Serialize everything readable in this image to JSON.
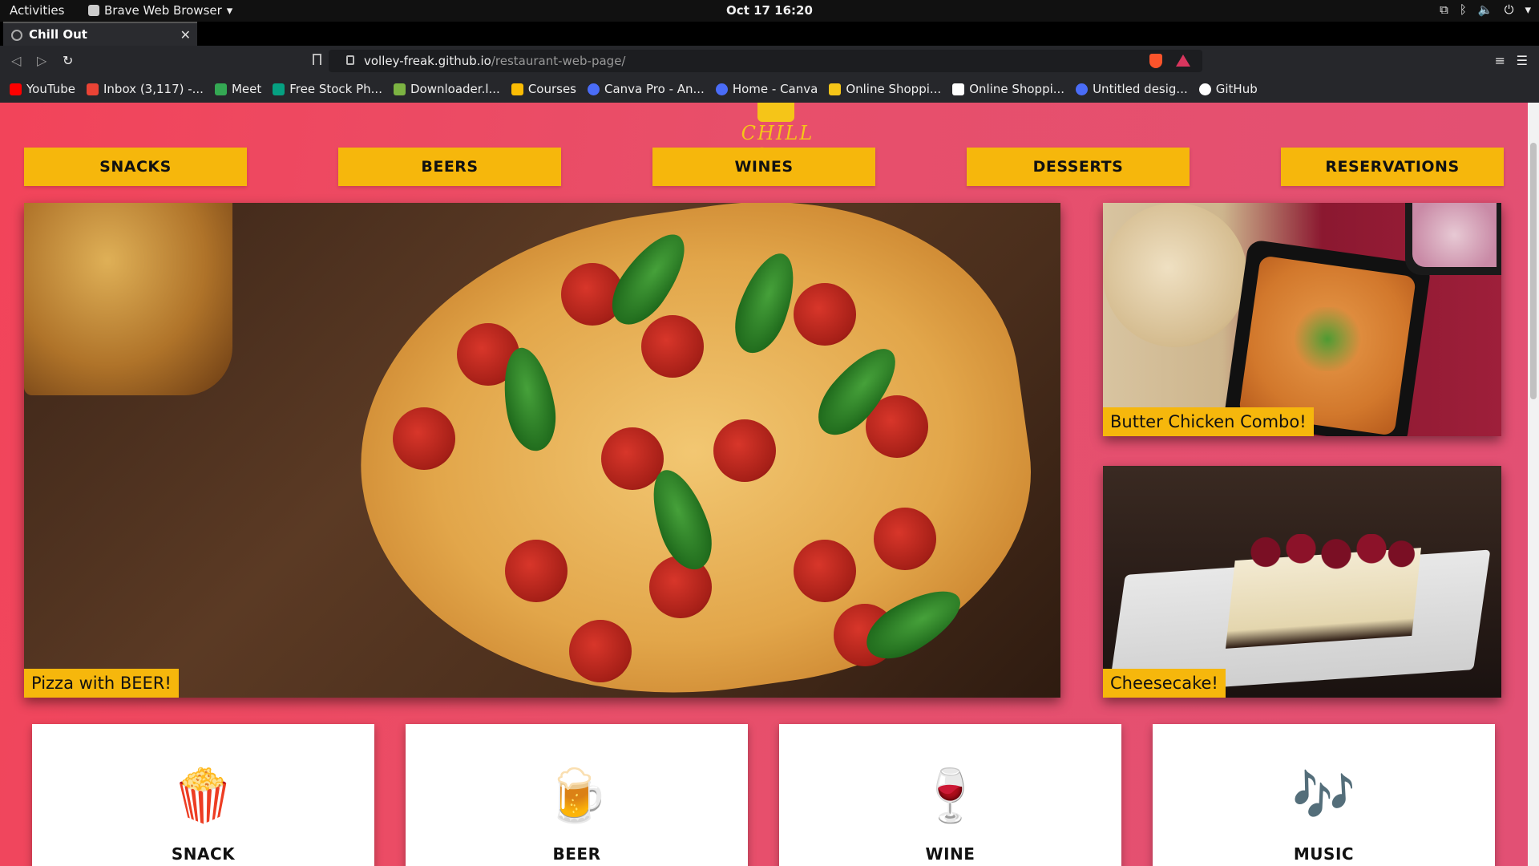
{
  "system": {
    "activities": "Activities",
    "app_name": "Brave Web Browser",
    "clock": "Oct 17  16:20"
  },
  "browser": {
    "tab_title": "Chill Out",
    "url_host": "volley-freak.github.io",
    "url_path": "/restaurant-web-page/",
    "bookmarks": [
      {
        "label": "YouTube",
        "color": "#ff0000"
      },
      {
        "label": "Inbox (3,117) -...",
        "color": "#ea4335"
      },
      {
        "label": "Meet",
        "color": "#34a853"
      },
      {
        "label": "Free Stock Ph...",
        "color": "#05a081"
      },
      {
        "label": "Downloader.l...",
        "color": "#7cb342"
      },
      {
        "label": "Courses",
        "color": "#fbbc04"
      },
      {
        "label": "Canva Pro - An...",
        "color": "#4a6cf7"
      },
      {
        "label": "Home - Canva",
        "color": "#4a6cf7"
      },
      {
        "label": "Online Shoppi...",
        "color": "#f5c518"
      },
      {
        "label": "Online Shoppi...",
        "color": "#ffffff"
      },
      {
        "label": "Untitled desig...",
        "color": "#4a6cf7"
      },
      {
        "label": "GitHub",
        "color": "#ffffff"
      }
    ]
  },
  "site": {
    "logo_text": "CHILL OUT",
    "brand_color": "#f6b70c",
    "nav": [
      "SNACKS",
      "BEERS",
      "WINES",
      "DESSERTS",
      "RESERVATIONS"
    ],
    "tiles": {
      "main_caption": "Pizza with BEER!",
      "side1_caption": "Butter Chicken Combo!",
      "side2_caption": "Cheesecake!"
    },
    "cards": [
      {
        "title": "SNACK",
        "icon": "snack-icon",
        "glyph": "🍿"
      },
      {
        "title": "BEER",
        "icon": "beer-icon",
        "glyph": "🍺"
      },
      {
        "title": "WINE",
        "icon": "wine-icon",
        "glyph": "🍷"
      },
      {
        "title": "MUSIC",
        "icon": "music-icon",
        "glyph": "🎶"
      }
    ]
  }
}
